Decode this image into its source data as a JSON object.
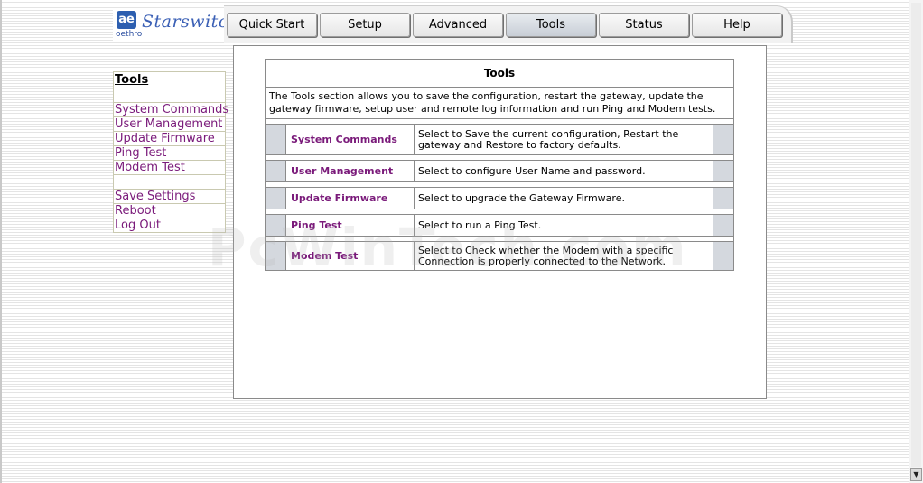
{
  "logo": {
    "mark": "ae",
    "company": "oethro",
    "product": "Starswitch"
  },
  "tabs": [
    {
      "label": "Quick Start",
      "active": false
    },
    {
      "label": "Setup",
      "active": false
    },
    {
      "label": "Advanced",
      "active": false
    },
    {
      "label": "Tools",
      "active": true
    },
    {
      "label": "Status",
      "active": false
    },
    {
      "label": "Help",
      "active": false
    }
  ],
  "sidebar": {
    "title": "Tools",
    "group1": [
      "System Commands",
      "User Management",
      "Update Firmware",
      "Ping Test",
      "Modem Test"
    ],
    "group2": [
      "Save Settings",
      "Reboot",
      "Log Out"
    ]
  },
  "main": {
    "title": "Tools",
    "intro": "The Tools section allows you to save the configuration, restart the gateway, update the gateway firmware, setup user and remote log information and run Ping and Modem tests.",
    "rows": [
      {
        "name": "System Commands",
        "description": "Select to Save the current configuration, Restart the gateway and Restore to factory defaults."
      },
      {
        "name": "User Management",
        "description": "Select to configure User Name and password."
      },
      {
        "name": "Update Firmware",
        "description": "Select to upgrade the Gateway Firmware."
      },
      {
        "name": "Ping Test",
        "description": "Select to run a Ping Test."
      },
      {
        "name": "Modem Test",
        "description": "Select to Check whether the Modem with a specific Connection is properly connected to the Network."
      }
    ]
  },
  "watermark": "PcWinTech.com",
  "colors": {
    "link": "#7a1a7a",
    "tab_active": "#c8ced6",
    "row_edge": "#d4d8de"
  },
  "scrollbar": {
    "down_arrow": "▼"
  }
}
